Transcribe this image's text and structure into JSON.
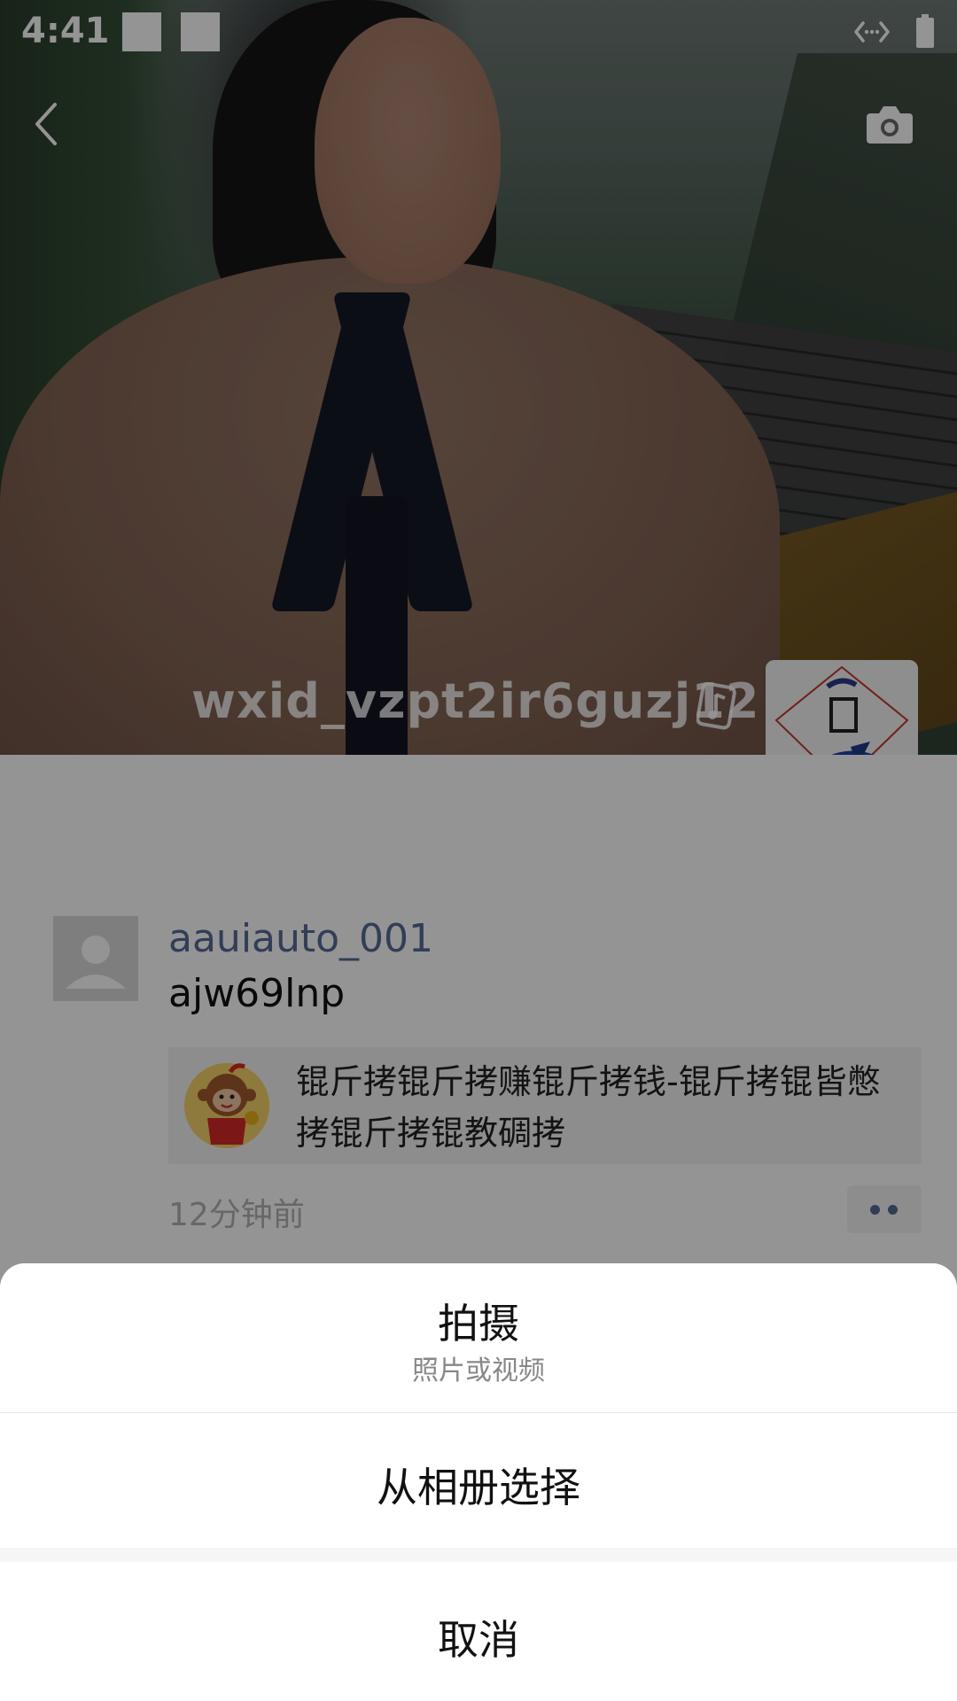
{
  "status_bar": {
    "time": "4:41"
  },
  "cover": {
    "name": "wxid_vzpt2ir6guzj12"
  },
  "post": {
    "author": "aauiauto_001",
    "text": "ajw69lnp",
    "link_title": "锟斤拷锟斤拷赚锟斤拷钱-锟斤拷锟皆憋拷锟斤拷锟教碉拷",
    "time": "12分钟前"
  },
  "action_sheet": {
    "shoot_label": "拍摄",
    "shoot_subtitle": "照片或视频",
    "album_label": "从相册选择",
    "cancel_label": "取消"
  },
  "colors": {
    "link_blue": "#576b95",
    "overlay": "rgba(0,0,0,0.42)"
  }
}
